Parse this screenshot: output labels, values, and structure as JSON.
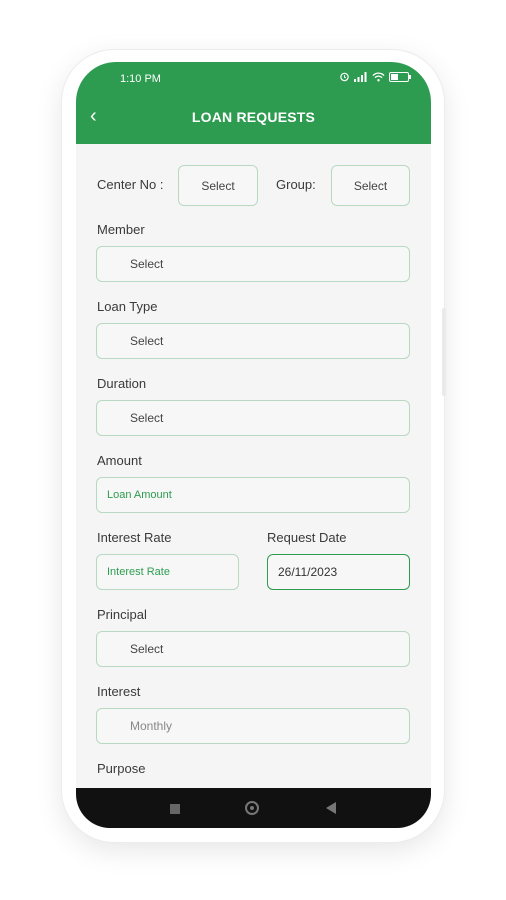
{
  "status_bar": {
    "time": "1:10 PM",
    "icons": [
      "alarm-icon",
      "signal-icon",
      "wifi-icon",
      "battery-icon"
    ]
  },
  "header": {
    "title": "LOAN REQUESTS",
    "back_icon": "back-arrow-icon"
  },
  "colors": {
    "primary": "#2e9c50",
    "field_border": "#b7d9c2",
    "background": "#f5f5f5"
  },
  "form": {
    "center_no": {
      "label": "Center No :",
      "value": "Select"
    },
    "group": {
      "label": "Group:",
      "value": "Select"
    },
    "member": {
      "label": "Member",
      "value": "Select"
    },
    "loan_type": {
      "label": "Loan Type",
      "value": "Select"
    },
    "duration": {
      "label": "Duration",
      "value": "Select"
    },
    "amount": {
      "label": "Amount",
      "placeholder": "Loan Amount"
    },
    "interest_rate": {
      "label": "Interest Rate",
      "placeholder": "Interest Rate"
    },
    "request_date": {
      "label": "Request Date",
      "value": "26/11/2023"
    },
    "principal": {
      "label": "Principal",
      "value": "Select"
    },
    "interest": {
      "label": "Interest",
      "value": "Monthly"
    },
    "purpose": {
      "label": "Purpose"
    }
  },
  "nav_bar": {
    "icons": [
      "recent-apps-icon",
      "home-icon",
      "back-icon"
    ]
  }
}
